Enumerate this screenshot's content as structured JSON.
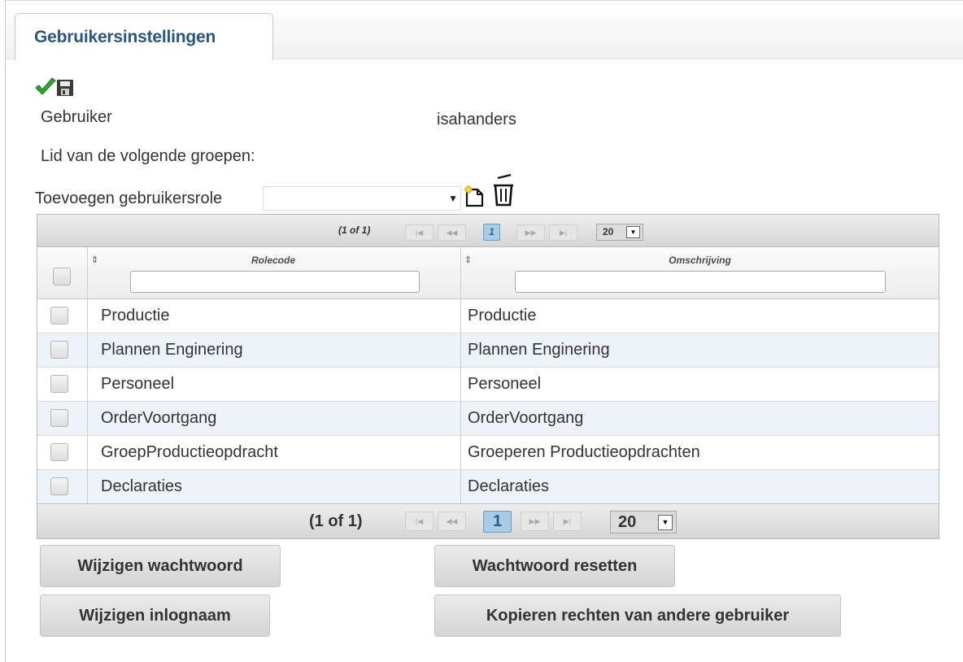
{
  "tab": {
    "label": "Gebruikersinstellingen"
  },
  "toolbar": {
    "icons": [
      "check-icon",
      "save-icon"
    ]
  },
  "user": {
    "label": "Gebruiker",
    "value": "isahanders"
  },
  "groups": {
    "label": "Lid van de volgende groepen:"
  },
  "add_role": {
    "label": "Toevoegen gebruikersrole",
    "selected": ""
  },
  "grid": {
    "pager_top": {
      "text": "(1 of 1)",
      "current_page": "1",
      "rows_per_page": "20"
    },
    "pager_bottom": {
      "text": "(1 of 1)",
      "current_page": "1",
      "rows_per_page": "20"
    },
    "columns": {
      "rolecode": "Rolecode",
      "omschrijving": "Omschrijving"
    },
    "rows": [
      {
        "rolecode": "Productie",
        "omschrijving": "Productie"
      },
      {
        "rolecode": "Plannen Enginering",
        "omschrijving": "Plannen Enginering"
      },
      {
        "rolecode": "Personeel",
        "omschrijving": "Personeel"
      },
      {
        "rolecode": "OrderVoortgang",
        "omschrijving": "OrderVoortgang"
      },
      {
        "rolecode": "GroepProductieopdracht",
        "omschrijving": "Groeperen Productieopdrachten"
      },
      {
        "rolecode": "Declaraties",
        "omschrijving": "Declaraties"
      }
    ]
  },
  "buttons": {
    "change_password": "Wijzigen wachtwoord",
    "reset_password": "Wachtwoord resetten",
    "change_login": "Wijzigen inlognaam",
    "copy_rights": "Kopieren rechten van andere gebruiker"
  },
  "colors": {
    "tab_title": "#2b5680",
    "row_alt": "#eef3fa",
    "page_current": "#a7cde6"
  }
}
